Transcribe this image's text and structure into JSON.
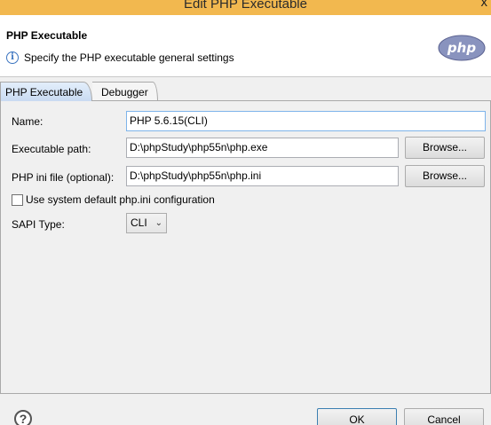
{
  "window": {
    "title": "Edit PHP Executable",
    "close_glyph": "x"
  },
  "banner": {
    "heading": "PHP Executable",
    "info_text": "Specify the PHP executable general settings",
    "logo_text": "php",
    "logo_color": "#8993be"
  },
  "tabs": [
    {
      "label": "PHP Executable",
      "active": true
    },
    {
      "label": "Debugger",
      "active": false
    }
  ],
  "form": {
    "name_label": "Name:",
    "name_value": "PHP 5.6.15(CLI)",
    "exe_label": "Executable path:",
    "exe_value": "D:\\phpStudy\\php55n\\php.exe",
    "ini_label": "PHP ini file (optional):",
    "ini_value": "D:\\phpStudy\\php55n\\php.ini",
    "browse_label": "Browse...",
    "checkbox_label": "Use system default php.ini configuration",
    "checkbox_checked": false,
    "sapi_label": "SAPI Type:",
    "sapi_value": "CLI"
  },
  "footer": {
    "help_glyph": "?",
    "ok_label": "OK",
    "cancel_label": "Cancel"
  }
}
